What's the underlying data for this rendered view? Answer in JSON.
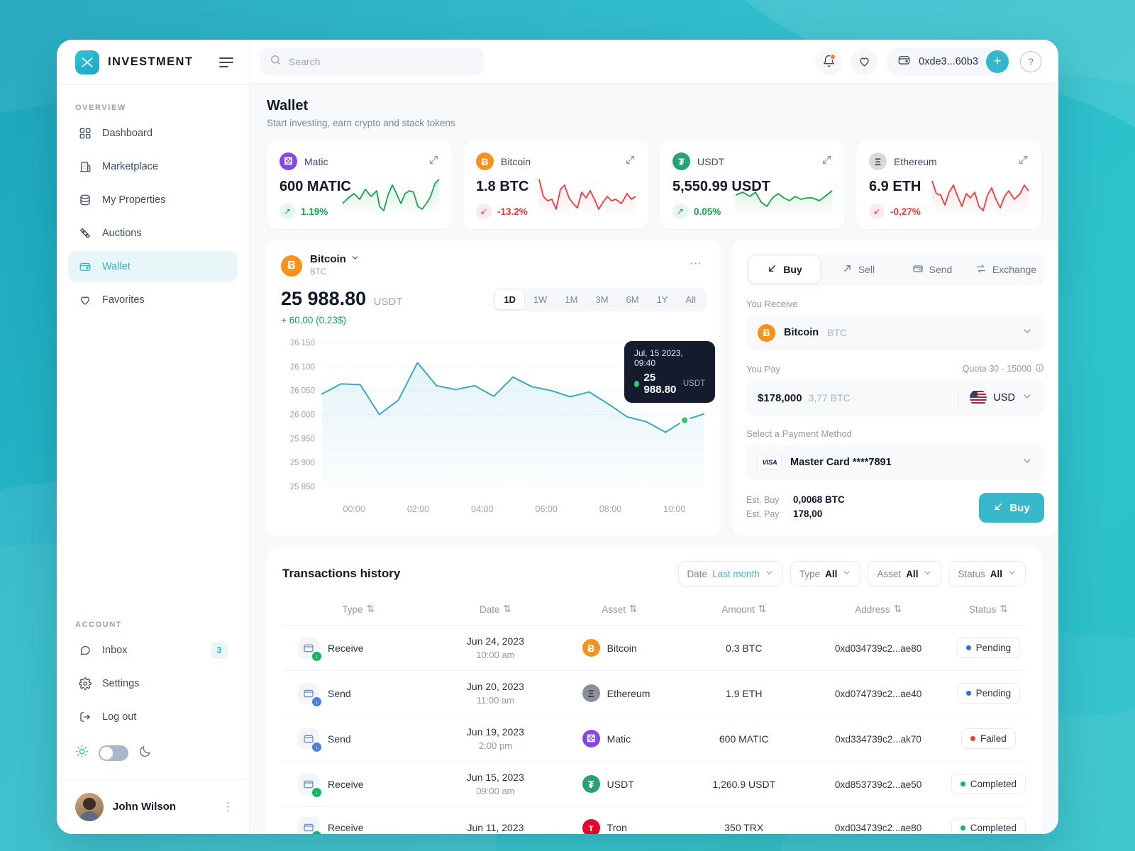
{
  "brand": {
    "name": "INVESTMENT",
    "logo_icon": "logo-mark-icon"
  },
  "sidebar": {
    "overview_label": "OVERVIEW",
    "account_label": "ACCOUNT",
    "overview_items": [
      {
        "label": "Dashboard",
        "icon": "grid-icon",
        "active": false
      },
      {
        "label": "Marketplace",
        "icon": "building-icon",
        "active": false
      },
      {
        "label": "My Properties",
        "icon": "database-icon",
        "active": false
      },
      {
        "label": "Auctions",
        "icon": "ticket-icon",
        "active": false
      },
      {
        "label": "Wallet",
        "icon": "wallet-icon",
        "active": true
      },
      {
        "label": "Favorites",
        "icon": "heart-icon",
        "active": false
      }
    ],
    "account_items": [
      {
        "label": "Inbox",
        "icon": "chat-icon",
        "badge": "3"
      },
      {
        "label": "Settings",
        "icon": "gear-icon",
        "badge": ""
      },
      {
        "label": "Log out",
        "icon": "logout-icon",
        "badge": ""
      }
    ],
    "theme": {
      "light_icon": "sun-icon",
      "dark_icon": "moon-icon"
    },
    "profile": {
      "name": "John Wilson",
      "menu_icon": "vertical-dots-icon"
    }
  },
  "topbar": {
    "search_placeholder": "Search",
    "search_value": "",
    "search_icon": "search-icon",
    "notifications_icon": "bell-icon",
    "favorites_icon": "heart-icon",
    "wallet_icon": "card-icon",
    "wallet_address": "0xde3...60b3",
    "add_label": "+",
    "help_label": "?"
  },
  "page": {
    "title": "Wallet",
    "subtitle": "Start investing, earn crypto and stack tokens"
  },
  "asset_cards": [
    {
      "name": "Matic",
      "symbol": "MATIC",
      "amount": "600 MATIC",
      "change": "1.19%",
      "direction": "up",
      "color": "#8247e5",
      "glyph": "⚄",
      "spark_color": "#16a34a"
    },
    {
      "name": "Bitcoin",
      "symbol": "BTC",
      "amount": "1.8 BTC",
      "change": "-13.2%",
      "direction": "down",
      "color": "#f7931a",
      "glyph": "Ƀ",
      "spark_color": "#ef3b3b"
    },
    {
      "name": "USDT",
      "symbol": "USDT",
      "amount": "5,550.99 USDT",
      "change": "0.05%",
      "direction": "up",
      "color": "#26a17b",
      "glyph": "₮",
      "spark_color": "#16a34a"
    },
    {
      "name": "Ethereum",
      "symbol": "ETH",
      "amount": "6.9 ETH",
      "change": "-0,27%",
      "direction": "down",
      "color": "#8a8f9b",
      "glyph": "Ξ",
      "spark_color": "#ef3b3b"
    }
  ],
  "chart_panel": {
    "coin_name": "Bitcoin",
    "coin_symbol": "BTC",
    "price": "25 988.80",
    "price_unit": "USDT",
    "delta": "+ 60,00 (0,23$)",
    "menu_icon": "ellipsis-icon",
    "chevron_icon": "chevron-down-icon",
    "ranges": [
      {
        "label": "1D",
        "active": true
      },
      {
        "label": "1W",
        "active": false
      },
      {
        "label": "1M",
        "active": false
      },
      {
        "label": "3M",
        "active": false
      },
      {
        "label": "6M",
        "active": false
      },
      {
        "label": "1Y",
        "active": false
      },
      {
        "label": "All",
        "active": false
      }
    ],
    "tooltip": {
      "time": "Jul, 15 2023, 09:40",
      "value": "25 988.80",
      "unit": "USDT"
    }
  },
  "chart_data": {
    "type": "line",
    "title": "Bitcoin BTC price",
    "xlabel": "",
    "ylabel": "USDT",
    "ylim": [
      25850,
      26150
    ],
    "yticks": [
      "26 150",
      "26 100",
      "26 050",
      "26 000",
      "25 950",
      "25 900",
      "25 850"
    ],
    "ytick_values": [
      26150,
      26100,
      26050,
      26000,
      25950,
      25900,
      25850
    ],
    "xticks": [
      "00:00",
      "02:00",
      "04:00",
      "06:00",
      "08:00",
      "10:00"
    ],
    "grid": true,
    "legend": "none",
    "line_color": "#3aa8c4",
    "fill": true,
    "series": [
      {
        "name": "BTC/USDT",
        "values": [
          26043,
          26064,
          26062,
          26000,
          26030,
          26108,
          26060,
          26052,
          26060,
          26038,
          26078,
          26058,
          26050,
          26037,
          26047,
          26022,
          25995,
          25985,
          25963,
          25988,
          26001
        ]
      }
    ],
    "highlight_point": {
      "index": 19,
      "value": 25988.8,
      "label": "Jul, 15 2023, 09:40",
      "color": "#36c66e"
    }
  },
  "buy_panel": {
    "tabs": [
      {
        "label": "Buy",
        "icon": "arrow-down-left-icon",
        "active": true
      },
      {
        "label": "Sell",
        "icon": "arrow-up-right-icon",
        "active": false
      },
      {
        "label": "Send",
        "icon": "send-card-icon",
        "active": false
      },
      {
        "label": "Exchange",
        "icon": "exchange-icon",
        "active": false
      }
    ],
    "receive_label": "You Receive",
    "receive_coin_name": "Bitcoin",
    "receive_coin_symbol": "BTC",
    "pay_label": "You Pay",
    "quota_label": "Quota 30 - 15000",
    "quota_info_icon": "info-icon",
    "pay_amount": "$178,000",
    "pay_conversion": "3,77 BTC",
    "currency": "USD",
    "currency_flag": "us-flag-icon",
    "payment_method_label": "Select a Payment Method",
    "payment_method": "Master Card ****7891",
    "payment_brand": "VISA",
    "est_buy_label": "Est. Buy",
    "est_buy_value": "0,0068 BTC",
    "est_pay_label": "Est. Pay",
    "est_pay_value": "178,00",
    "buy_button": "Buy"
  },
  "transactions": {
    "title": "Transactions history",
    "filters": [
      {
        "label": "Date",
        "value": "Last month",
        "highlight": true
      },
      {
        "label": "Type",
        "value": "All",
        "highlight": false
      },
      {
        "label": "Asset",
        "value": "All",
        "highlight": false
      },
      {
        "label": "Status",
        "value": "All",
        "highlight": false
      }
    ],
    "columns": [
      "Type",
      "Date",
      "Asset",
      "Amount",
      "Address",
      "Status"
    ],
    "rows": [
      {
        "type": "Receive",
        "type_dir": "recv",
        "date": "Jun 24, 2023",
        "time": "10:00 am",
        "asset": "Bitcoin",
        "asset_color": "#f7931a",
        "asset_glyph": "Ƀ",
        "amount": "0.3 BTC",
        "address": "0xd034739c2...ae80",
        "status": "Pending",
        "status_key": "pending"
      },
      {
        "type": "Send",
        "type_dir": "send",
        "date": "Jun 20, 2023",
        "time": "11:00 am",
        "asset": "Ethereum",
        "asset_color": "#8a8f9b",
        "asset_glyph": "Ξ",
        "amount": "1.9 ETH",
        "address": "0xd074739c2...ae40",
        "status": "Pending",
        "status_key": "pending"
      },
      {
        "type": "Send",
        "type_dir": "send",
        "date": "Jun 19, 2023",
        "time": "2:00 pm",
        "asset": "Matic",
        "asset_color": "#8247e5",
        "asset_glyph": "⚄",
        "amount": "600 MATIC",
        "address": "0xd334739c2...ak70",
        "status": "Failed",
        "status_key": "failed"
      },
      {
        "type": "Receive",
        "type_dir": "recv",
        "date": "Jun 15, 2023",
        "time": "09:00 am",
        "asset": "USDT",
        "asset_color": "#26a17b",
        "asset_glyph": "₮",
        "amount": "1,260.9 USDT",
        "address": "0xd853739c2...ae50",
        "status": "Completed",
        "status_key": "completed"
      },
      {
        "type": "Receive",
        "type_dir": "recv",
        "date": "Jun 11, 2023",
        "time": "",
        "asset": "Tron",
        "asset_color": "#eb0029",
        "asset_glyph": "ᴛ",
        "amount": "350 TRX",
        "address": "0xd034739c2...ae80",
        "status": "Completed",
        "status_key": "completed"
      }
    ]
  },
  "colors": {
    "accent": "#39b7cb",
    "positive": "#14a44d",
    "negative": "#e23c3c",
    "ink": "#13182b",
    "muted": "#8d99ad"
  }
}
